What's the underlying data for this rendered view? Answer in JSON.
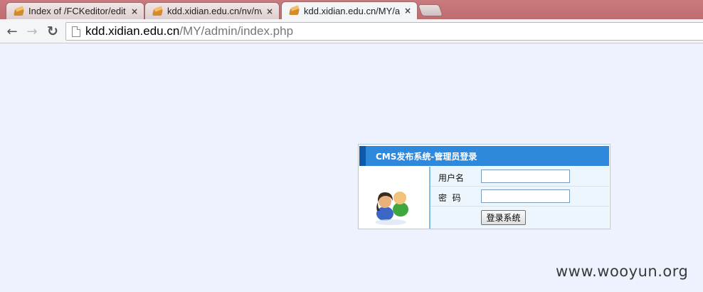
{
  "tabs": [
    {
      "label": "Index of /FCKeditor/edit",
      "close": "×"
    },
    {
      "label": "kdd.xidian.edu.cn/nv/nv",
      "close": "×"
    },
    {
      "label": "kdd.xidian.edu.cn/MY/a",
      "close": "×"
    }
  ],
  "toolbar": {
    "back_glyph": "←",
    "forward_glyph": "→",
    "reload_glyph": "↻",
    "url_host": "kdd.xidian.edu.cn",
    "url_path": "/MY/admin/index.php"
  },
  "login": {
    "title": "CMS发布系统-管理员登录",
    "username_label": "用户名",
    "password_label": "密  码",
    "username_value": "",
    "password_value": "",
    "submit_label": "登录系统",
    "avatar_icon": "users-icon"
  },
  "watermark": "www.wooyun.org",
  "colors": {
    "tabstrip": "#c97a7d",
    "page_bg": "#eef2fe",
    "panel_header": "#2e88dc",
    "panel_header_accent": "#0e5aa8"
  }
}
